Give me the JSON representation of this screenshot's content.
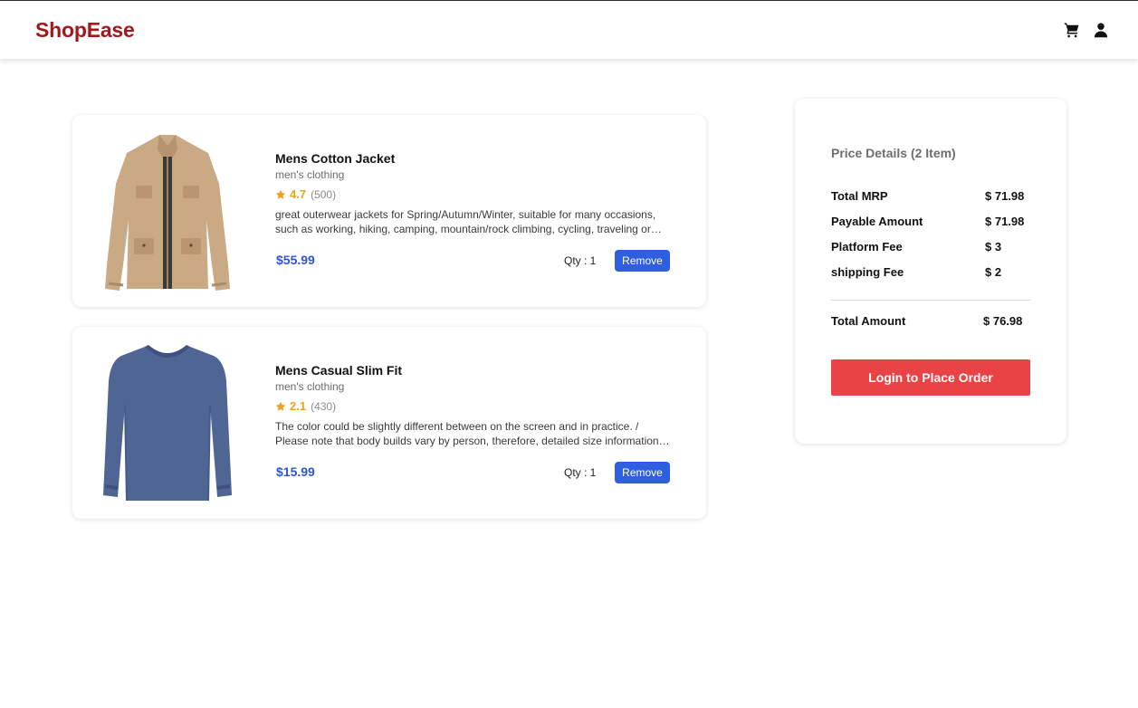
{
  "navbar": {
    "brand": "ShopEase",
    "icons": [
      "cart-icon",
      "user-icon"
    ],
    "brand_color": "#a3181c"
  },
  "cart": {
    "items": [
      {
        "title": "Mens Cotton Jacket",
        "category": "men's clothing",
        "rating": "4.7",
        "count": "(500)",
        "description": "great outerwear jackets for Spring/Autumn/Winter, suitable for many occasions, such as working, hiking, camping, mountain/rock climbing, cycling, traveling or other outdoors. Good gift choice for you or your family member. A warm hearted love to Father, husband or son in this thanksgiving or Christmas Day.",
        "price": "$55.99",
        "qty": "Qty : 1",
        "remove_label": "Remove"
      },
      {
        "title": "Mens Casual Slim Fit",
        "category": "men's clothing",
        "rating": "2.1",
        "count": "(430)",
        "description": "The color could be slightly different between on the screen and in practice. / Please note that body builds vary by person, therefore, detailed size information should be reviewed below on the product description.",
        "price": "$15.99",
        "qty": "Qty : 1",
        "remove_label": "Remove"
      }
    ]
  },
  "summary": {
    "heading": "Price Details (2 Item)",
    "lines": [
      {
        "label": "Total MRP",
        "value": "$ 71.98"
      },
      {
        "label": "Payable Amount",
        "value": "$ 71.98"
      },
      {
        "label": "Platform Fee",
        "value": "$ 3"
      },
      {
        "label": "shipping Fee",
        "value": "$ 2"
      }
    ],
    "total_label": "Total Amount",
    "total_value": "$ 76.98",
    "button_label": "Login to Place Order",
    "button_color": "#ea4345"
  },
  "colors": {
    "price": "#2f55d4",
    "remove_button": "#2f5fe0",
    "star": "#e8a21b"
  }
}
